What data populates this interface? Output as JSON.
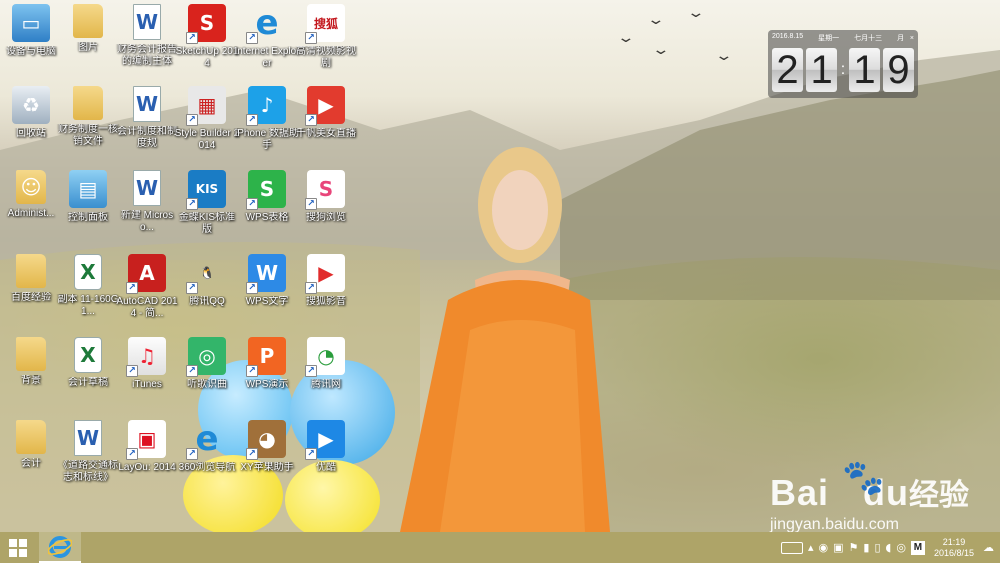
{
  "desktop": {
    "icons": [
      {
        "label": "设备与电脑",
        "icon": "computer-icon",
        "shortcut": false
      },
      {
        "label": "图片",
        "icon": "folder-icon",
        "shortcut": false
      },
      {
        "label": "财务会计报告的编制主体",
        "icon": "word-doc-icon",
        "shortcut": false
      },
      {
        "label": "SketchUp 2014",
        "icon": "sketchup-icon",
        "shortcut": true
      },
      {
        "label": "Internet Explorer",
        "icon": "ie-icon",
        "shortcut": true
      },
      {
        "label": "高清视频影视剧",
        "icon": "sohu-video-icon",
        "shortcut": true
      },
      {
        "label": "回收站",
        "icon": "recycle-bin-icon",
        "shortcut": false
      },
      {
        "label": "财务制度一核销文件",
        "icon": "folder-icon",
        "shortcut": false
      },
      {
        "label": "会计制度和制度规",
        "icon": "word-doc-icon",
        "shortcut": false
      },
      {
        "label": "Style Builder 2014",
        "icon": "style-builder-icon",
        "shortcut": true
      },
      {
        "label": "iPhone 数据助手",
        "icon": "iphone-helper-icon",
        "shortcut": true
      },
      {
        "label": "千帆美女直播",
        "icon": "live-stream-icon",
        "shortcut": true
      },
      {
        "label": "Administ...",
        "icon": "user-folder-icon",
        "shortcut": false
      },
      {
        "label": "控制面板",
        "icon": "control-panel-icon",
        "shortcut": false
      },
      {
        "label": "新建 Microso...",
        "icon": "word-doc-icon",
        "shortcut": false
      },
      {
        "label": "金蝶KIS标准版",
        "icon": "kis-icon",
        "shortcut": true
      },
      {
        "label": "WPS表格",
        "icon": "wps-sheet-icon",
        "shortcut": true
      },
      {
        "label": "搜狗浏览",
        "icon": "sogou-icon",
        "shortcut": true
      },
      {
        "label": "百度经验",
        "icon": "folder-icon",
        "shortcut": false
      },
      {
        "label": "副本 11-160G1...",
        "icon": "excel-icon",
        "shortcut": false
      },
      {
        "label": "AutoCAD 2014 - 简...",
        "icon": "autocad-icon",
        "shortcut": true
      },
      {
        "label": "腾讯QQ",
        "icon": "qq-icon",
        "shortcut": true
      },
      {
        "label": "WPS文字",
        "icon": "wps-writer-icon",
        "shortcut": true
      },
      {
        "label": "搜狐影音",
        "icon": "sohu-player-icon",
        "shortcut": true
      },
      {
        "label": "背景",
        "icon": "folder-icon",
        "shortcut": false
      },
      {
        "label": "会计草稿",
        "icon": "excel-icon",
        "shortcut": false
      },
      {
        "label": "iTunes",
        "icon": "itunes-icon",
        "shortcut": true
      },
      {
        "label": "听歌识曲",
        "icon": "music-id-icon",
        "shortcut": true
      },
      {
        "label": "WPS演示",
        "icon": "wps-presentation-icon",
        "shortcut": true
      },
      {
        "label": "腾讯网",
        "icon": "tencent-news-icon",
        "shortcut": true
      },
      {
        "label": "会计",
        "icon": "folder-icon",
        "shortcut": false
      },
      {
        "label": "《道路交通标志和标线》",
        "icon": "word-doc-icon",
        "shortcut": false
      },
      {
        "label": "LayOu: 2014",
        "icon": "layout-icon",
        "shortcut": true
      },
      {
        "label": "360浏览导航",
        "icon": "ie-blue-icon",
        "shortcut": true
      },
      {
        "label": "XY苹果助手",
        "icon": "xy-owl-icon",
        "shortcut": true
      },
      {
        "label": "优酷",
        "icon": "video-player-icon",
        "shortcut": true
      }
    ]
  },
  "clock_widget": {
    "date": "2016.8.15",
    "weekday": "星期一",
    "lunar": "七月十三",
    "month_btn": "月",
    "close": "×",
    "hour": "21",
    "minute": "19"
  },
  "watermark": {
    "brand": "Bai",
    "brand_end": "du",
    "jingyan": "经验",
    "url": "jingyan.baidu.com"
  },
  "taskbar": {
    "start_icon": "windows-logo-icon",
    "pinned": [
      {
        "icon": "ie-icon",
        "label": "Internet Explorer"
      }
    ],
    "tray": {
      "input_method": "keyboard-icon",
      "time": "21:19",
      "date": "2016/8/15",
      "ime": "M"
    }
  },
  "colors": {
    "taskbar": "#aaa05f",
    "ie_blue": "#1f8ad6",
    "wps_orange": "#f26522",
    "wps_green": "#2db34a",
    "qq_black": "#111111"
  }
}
